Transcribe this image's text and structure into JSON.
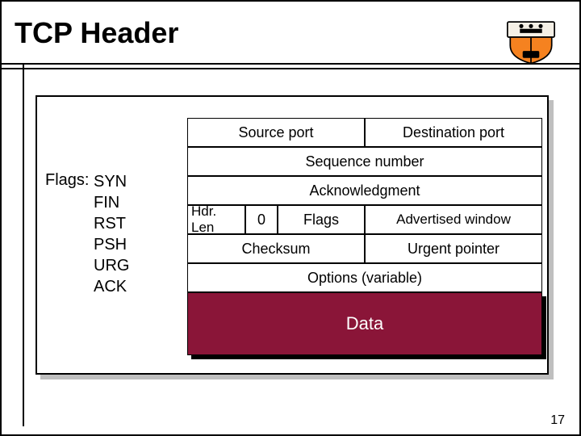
{
  "title": "TCP Header",
  "logo_name": "university-shield-icon",
  "flags": {
    "label": "Flags:",
    "items": [
      "SYN",
      "FIN",
      "RST",
      "PSH",
      "URG",
      "ACK"
    ]
  },
  "header": {
    "source_port": "Source port",
    "dest_port": "Destination port",
    "sequence": "Sequence number",
    "ack": "Acknowledgment",
    "hdr_len": "Hdr. Len",
    "reserved": "0",
    "flags_field": "Flags",
    "adv_window": "Advertised window",
    "checksum": "Checksum",
    "urgent_ptr": "Urgent pointer",
    "options": "Options (variable)",
    "data": "Data"
  },
  "colors": {
    "data_bg": "#8a1538",
    "shadow": "#bfbfbf"
  },
  "page_number": "17"
}
